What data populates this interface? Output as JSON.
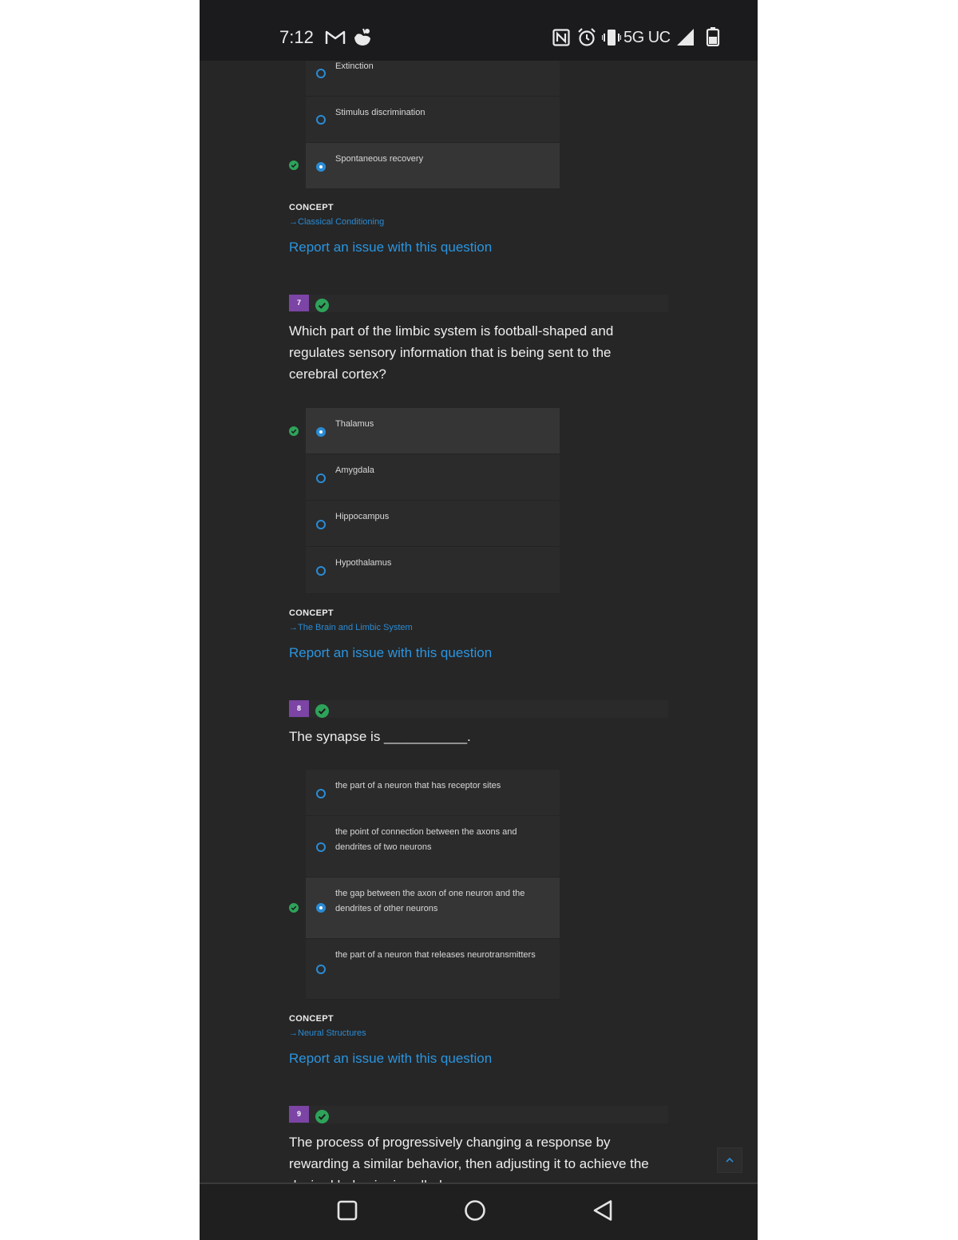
{
  "status_bar": {
    "time": "7:12",
    "network": "5G UC",
    "icons": [
      "gmail-icon",
      "app-notification-icon",
      "nfc-icon",
      "alarm-icon",
      "vibrate-icon",
      "signal-icon",
      "battery-icon"
    ]
  },
  "question6": {
    "choices": [
      {
        "text": "Extinction",
        "selected": false,
        "correct": false
      },
      {
        "text": "Stimulus discrimination",
        "selected": false,
        "correct": false
      },
      {
        "text": "Spontaneous recovery",
        "selected": true,
        "correct": true
      }
    ],
    "concept_label": "CONCEPT",
    "concept_link": "Classical Conditioning",
    "report_link": "Report an issue with this question"
  },
  "question7": {
    "number": "7",
    "text": "Which part of the limbic system is football-shaped and regulates sensory information that is being sent to the cerebral cortex?",
    "choices": [
      {
        "text": "Thalamus",
        "selected": true,
        "correct": true
      },
      {
        "text": "Amygdala",
        "selected": false,
        "correct": false
      },
      {
        "text": "Hippocampus",
        "selected": false,
        "correct": false
      },
      {
        "text": "Hypothalamus",
        "selected": false,
        "correct": false
      }
    ],
    "concept_label": "CONCEPT",
    "concept_link": "The Brain and Limbic System",
    "report_link": "Report an issue with this question"
  },
  "question8": {
    "number": "8",
    "text": "The synapse is ___________.",
    "choices": [
      {
        "text": "the part of a neuron that has receptor sites",
        "selected": false,
        "correct": false
      },
      {
        "text": "the point of connection between the axons and dendrites of two neurons",
        "selected": false,
        "correct": false
      },
      {
        "text": "the gap between the axon of one neuron and the dendrites of other neurons",
        "selected": true,
        "correct": true
      },
      {
        "text": "the part of a neuron that releases neurotransmitters",
        "selected": false,
        "correct": false
      }
    ],
    "concept_label": "CONCEPT",
    "concept_link": "Neural Structures",
    "report_link": "Report an issue with this question"
  },
  "question9": {
    "number": "9",
    "text": "The process of progressively changing a response by rewarding a similar behavior, then adjusting it to achieve the desired behavior is called..."
  },
  "colors": {
    "accent": "#2a8bd4",
    "correct": "#2ea35a",
    "badge": "#7b44a5",
    "background": "#262626"
  }
}
